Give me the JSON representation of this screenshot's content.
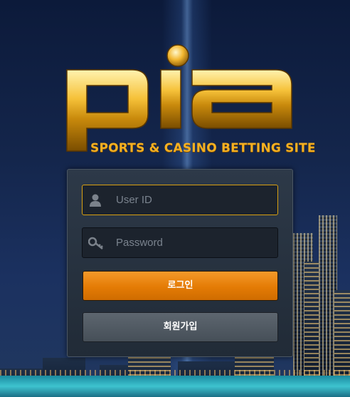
{
  "brand": {
    "logo_text": "pia",
    "tagline": "SPORTS & CASINO BETTING SITE",
    "accent_color": "#f5b021"
  },
  "login_form": {
    "user_id": {
      "placeholder": "User ID",
      "value": "",
      "icon": "user-icon"
    },
    "password": {
      "placeholder": "Password",
      "value": "",
      "icon": "key-icon"
    },
    "login_button": "로그인",
    "signup_button": "회원가입",
    "login_button_color": "#e47b05"
  }
}
